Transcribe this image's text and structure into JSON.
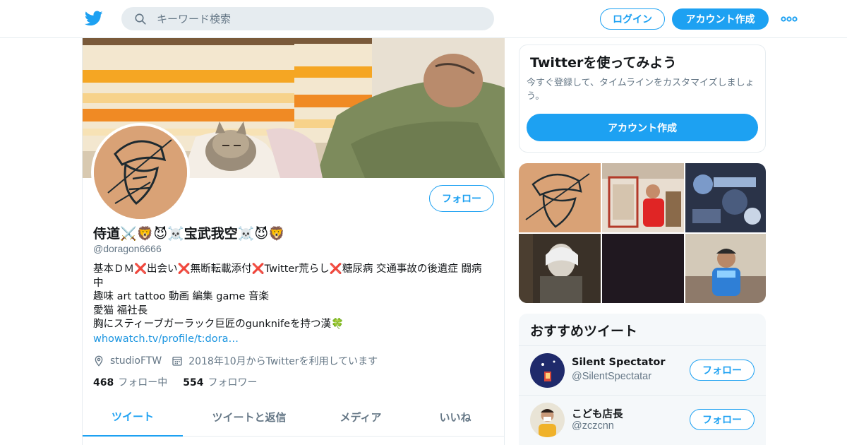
{
  "header": {
    "search_placeholder": "キーワード検索",
    "login_label": "ログイン",
    "signup_label": "アカウント作成"
  },
  "profile": {
    "follow_label": "フォロー",
    "name": "侍道⚔️🦁😈☠️宝武我空☠️😈🦁",
    "handle": "@doragon6666",
    "bio_lines": [
      "基本ＤＭ❌出会い❌無断転載添付❌Twitter荒らし❌糖尿病 交通事故の後遺症 闘病",
      "中",
      "趣味 art tattoo 動画 編集 game 音楽",
      "愛猫 福社長",
      "胸にスティーブガーラック巨匠のgunknifeを持つ漢🍀"
    ],
    "link": "whowatch.tv/profile/t:dora…",
    "location": "studioFTW",
    "joined": "2018年10月からTwitterを利用しています",
    "following_count": "468",
    "following_label": "フォロー中",
    "followers_count": "554",
    "followers_label": "フォロワー",
    "tabs": [
      {
        "label": "ツイート"
      },
      {
        "label": "ツイートと返信"
      },
      {
        "label": "メディア"
      },
      {
        "label": "いいね"
      }
    ]
  },
  "sidebar": {
    "signup_card": {
      "title": "Twitterを使ってみよう",
      "description": "今すぐ登録して、タイムラインをカスタマイズしましょう。",
      "button": "アカウント作成"
    },
    "recommended": {
      "title": "おすすめツイート",
      "accounts": [
        {
          "name": "Silent Spectator",
          "handle": "@SilentSpectatar",
          "button": "フォロー"
        },
        {
          "name": "こども店長",
          "handle": "@zczcnn",
          "button": "フォロー"
        }
      ]
    }
  },
  "colors": {
    "accent": "#1da1f2",
    "text": "#14171a",
    "secondary_text": "#657786",
    "link": "#1b95e0",
    "border": "#e6ecf0"
  },
  "icons": [
    "twitter-bird-icon",
    "search-icon",
    "more-icon",
    "location-pin-icon",
    "calendar-icon"
  ]
}
